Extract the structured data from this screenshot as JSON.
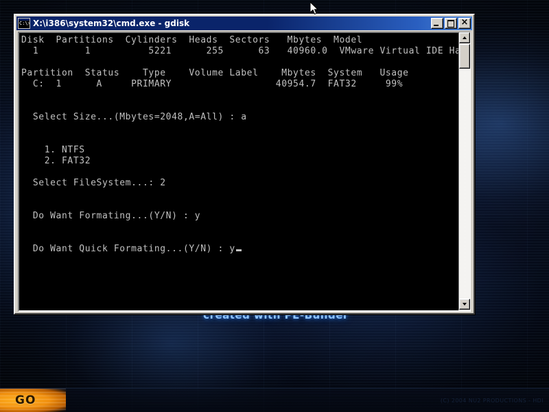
{
  "desktop": {
    "watermark": "created with PE-Builder",
    "copyright": "(C) 2004 NU2 PRODUCTIONS - HDI",
    "wallpaper_color": "#0a1226",
    "accent_color": "#2a6fd0"
  },
  "taskbar": {
    "start_label": "GO",
    "start_color": "#f09010"
  },
  "window": {
    "title": "X:\\i386\\system32\\cmd.exe - gdisk",
    "icon_glyph": "C:\\>",
    "titlebar_color": "#0a246a",
    "buttons": {
      "minimize": "Minimize",
      "maximize": "Maximize",
      "close": "Close"
    },
    "scrollbar": {
      "up_arrow": "Scroll up",
      "down_arrow": "Scroll down",
      "thumb": "Scroll thumb"
    }
  },
  "console": {
    "foreground_color": "#c0c0c0",
    "background_color": "#000000",
    "disk_table": {
      "headers": [
        "Disk",
        "Partitions",
        "Cylinders",
        "Heads",
        "Sectors",
        "Mbytes",
        "Model"
      ],
      "row": [
        "1",
        "1",
        "5221",
        "255",
        "63",
        "40960.0",
        "VMware Virtual IDE Hard Dr"
      ]
    },
    "partition_table": {
      "headers": [
        "Partition",
        "Status",
        "Type",
        "Volume Label",
        "Mbytes",
        "System",
        "Usage"
      ],
      "row": [
        "C:  1",
        "A",
        "PRIMARY",
        "",
        "40954.7",
        "FAT32",
        "99%"
      ]
    },
    "prompts": {
      "select_size": "Select Size...(Mbytes=2048,A=All) : a",
      "filesystem_option_1": "1. NTFS",
      "filesystem_option_2": "2. FAT32",
      "select_filesystem": "Select FileSystem...: 2",
      "do_want_formating": "Do Want Formating...(Y/N) : y",
      "do_want_quick_formating": "Do Want Quick Formating...(Y/N) : y"
    },
    "screen_text": "Disk  Partitions  Cylinders  Heads  Sectors   Mbytes  Model\n  1        1          5221      255      63   40960.0  VMware Virtual IDE Hard Dr\n\nPartition  Status    Type    Volume Label    Mbytes  System   Usage\n  C:  1      A     PRIMARY                  40954.7  FAT32     99%\n\n\n  Select Size...(Mbytes=2048,A=All) : a\n\n\n    1. NTFS\n    2. FAT32\n\n  Select FileSystem...: 2\n\n\n  Do Want Formating...(Y/N) : y\n\n\n  Do Want Quick Formating...(Y/N) : y"
  }
}
